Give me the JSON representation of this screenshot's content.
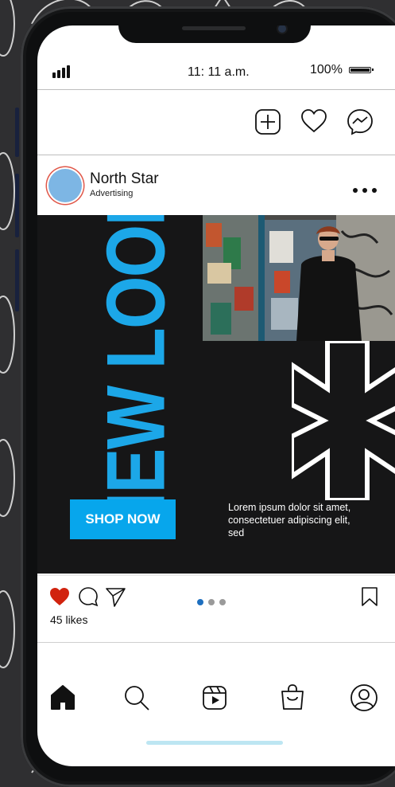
{
  "status_bar": {
    "time": "11: 11 a.m.",
    "battery_percent": "100%"
  },
  "top_bar": {
    "icons": [
      "add-post-icon",
      "heart-icon",
      "messenger-icon"
    ]
  },
  "post": {
    "account_name": "North Star",
    "account_subtitle": "Advertising",
    "headline": "NEW LOOK",
    "cta_label": "SHOP NOW",
    "body_text": "Lorem ipsum dolor sit amet, consectetuer adipiscing elit, sed",
    "likes": "45 likes",
    "carousel_pages": 3,
    "carousel_active": 1,
    "liked": true
  },
  "bottom_nav": {
    "items": [
      "home-icon",
      "search-icon",
      "reels-icon",
      "shop-icon",
      "profile-icon"
    ]
  },
  "colors": {
    "accent": "#1ca7e8",
    "cta": "#07a6ec",
    "like": "#d1230e",
    "post_bg": "#161617"
  }
}
